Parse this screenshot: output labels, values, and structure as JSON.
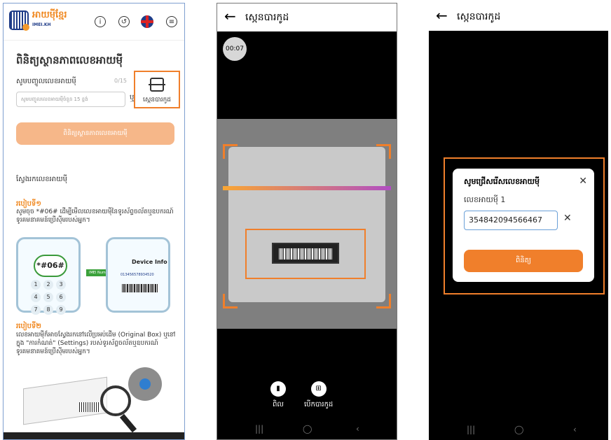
{
  "screen1": {
    "app_name": "អាយម៉ីខ្មែរ",
    "app_sub": "IMEI.KH",
    "title": "ពិនិត្យស្ថានភាពលេខអាយម៉ី",
    "input_label": "សូមបញ្ចូលលេខអាយម៉ី",
    "counter": "0/15",
    "input_placeholder": "សូមបញ្ចូលលេខអាយម៉ីចំនួន 15 ខ្ទង់",
    "or_text": "ឬ",
    "scan_label": "ស្កេនបារកូដ",
    "check_button": "ពិនិត្យស្ថានភាពលេខអាយម៉ី",
    "find_title": "ស្វែងរកលេខអាយម៉ី",
    "method1_title": "របៀបទី១",
    "method1_text": "សូមចុច *#06# ដើម្បីមើលលេខអាយម៉ីនៃទូរស័ព្ទចល័តឬឧបករណ៍ទូរគមនាគមន៍ប្រើស៊ីមរបស់អ្នក។",
    "dial_code": "*#06#",
    "keys": [
      "1",
      "2",
      "3",
      "4",
      "5",
      "6",
      "7",
      "8",
      "9"
    ],
    "imei_tag": "IMEI Number",
    "device_info": "Device Info",
    "device_number": "013456578934520",
    "method2_title": "របៀបទី២",
    "method2_text": "លេខអាយម៉ីក៏អាចស្វែងរកនៅលើប្រអប់ដើម (Original Box) ឬនៅក្នុង \"ការកំណត់\" (Settings) របស់ទូរស័ព្ទចល័តឬឧបករណ៍ទូរគមនាគមន៍ប្រើស៊ីមរបស់អ្នក។"
  },
  "screen2": {
    "back": "←",
    "title": "ស្កេនបារកូដ",
    "timer": "00:07",
    "flash_label": "ពិល",
    "gallery_label": "បើកបារកូដ"
  },
  "screen3": {
    "back": "←",
    "title": "ស្កេនបារកូដ",
    "dialog_title": "សូមជ្រើសរើសលេខអាយម៉ី",
    "imei_label": "លេខអាយម៉ី 1",
    "imei_value": "354842094566467",
    "confirm_button": "ពិនិត្យ"
  },
  "system_nav": {
    "recent": "|||",
    "home": "◯",
    "back": "‹"
  },
  "colors": {
    "accent": "#f07f2b",
    "brand_blue": "#1f3c88",
    "disabled_button": "#f6b789"
  }
}
